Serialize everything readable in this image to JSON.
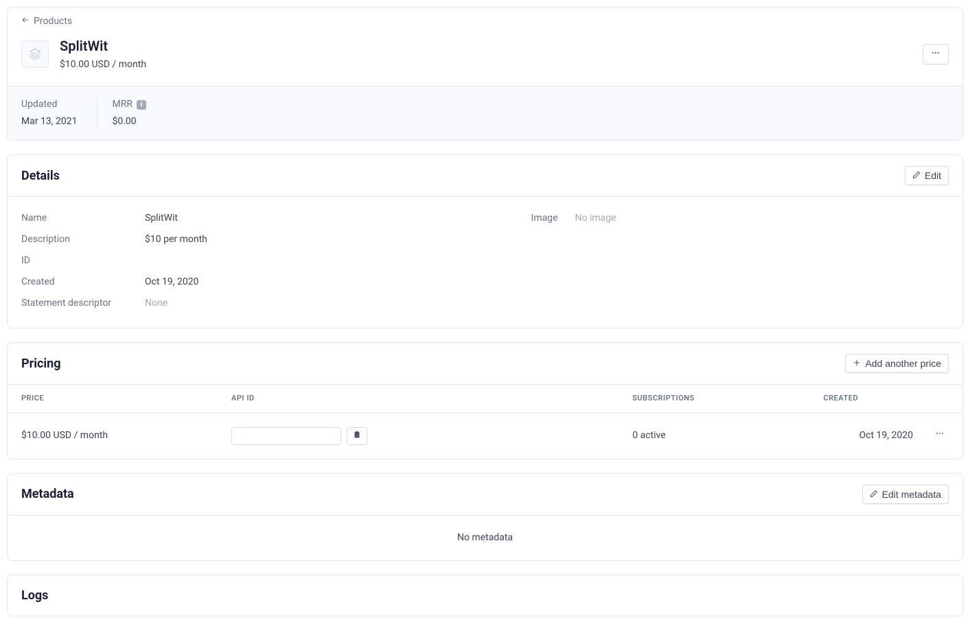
{
  "breadcrumb": {
    "back_label": "Products"
  },
  "product": {
    "name": "SplitWit",
    "price_line": "$10.00 USD / month"
  },
  "stats": {
    "updated_label": "Updated",
    "updated_value": "Mar 13, 2021",
    "mrr_label": "MRR",
    "mrr_value": "$0.00"
  },
  "details": {
    "title": "Details",
    "edit_label": "Edit",
    "name_label": "Name",
    "name_value": "SplitWit",
    "description_label": "Description",
    "description_value": "$10 per month",
    "id_label": "ID",
    "created_label": "Created",
    "created_value": "Oct 19, 2020",
    "statement_label": "Statement descriptor",
    "statement_value": "None",
    "image_label": "Image",
    "image_value": "No image"
  },
  "pricing": {
    "title": "Pricing",
    "add_label": "Add another price",
    "col_price": "PRICE",
    "col_api": "API ID",
    "col_subs": "SUBSCRIPTIONS",
    "col_created": "CREATED",
    "row": {
      "price": "$10.00 USD / month",
      "subs": "0 active",
      "created": "Oct 19, 2020"
    }
  },
  "metadata": {
    "title": "Metadata",
    "edit_label": "Edit metadata",
    "empty": "No metadata"
  },
  "logs": {
    "title": "Logs"
  }
}
